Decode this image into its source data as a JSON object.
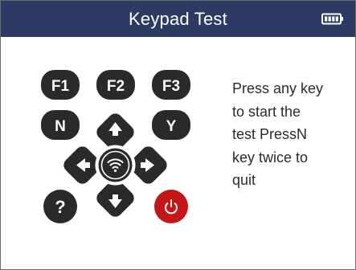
{
  "header": {
    "title": "Keypad Test",
    "battery_icon": "battery-full-icon"
  },
  "keypad": {
    "keys": {
      "f1": "F1",
      "f2": "F2",
      "f3": "F3",
      "n": "N",
      "y": "Y",
      "help": "?"
    },
    "icons": {
      "up": "arrow-up-icon",
      "down": "arrow-down-icon",
      "left": "arrow-left-icon",
      "right": "arrow-right-icon",
      "center": "wireless-icon",
      "power": "power-icon"
    },
    "colors": {
      "key": "#2a2a2a",
      "power": "#c41616",
      "header": "#2d3a63"
    }
  },
  "message": {
    "text": "Press any key\nto start the\ntest PressN\nkey twice to\nquit"
  }
}
